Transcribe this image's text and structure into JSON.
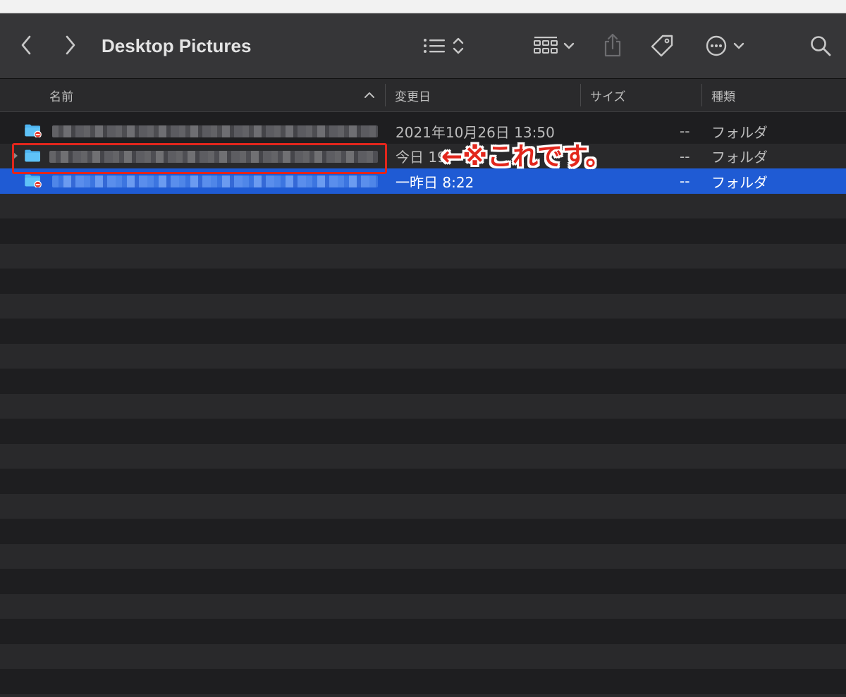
{
  "window": {
    "title": "Desktop Pictures"
  },
  "toolbar": {
    "icons": [
      "chevron-left-icon",
      "chevron-right-icon",
      "list-view-icon",
      "up-down-arrows-icon",
      "grid-group-icon",
      "chevron-down-icon",
      "share-icon",
      "tag-icon",
      "more-ellipsis-icon",
      "search-icon"
    ]
  },
  "columns": {
    "name": "名前",
    "modified": "変更日",
    "size": "サイズ",
    "kind": "種類"
  },
  "rows": [
    {
      "name": "",
      "modified": "2021年10月26日 13:50",
      "size": "--",
      "kind": "フォルダ",
      "icon": "folder-restricted-icon",
      "selected": false
    },
    {
      "name": "",
      "modified": "今日 19:",
      "size": "--",
      "kind": "フォルダ",
      "icon": "folder-icon",
      "selected": false
    },
    {
      "name": "",
      "modified": "一昨日 8:22",
      "size": "--",
      "kind": "フォルダ",
      "icon": "folder-restricted-icon",
      "selected": true
    }
  ],
  "annotation": {
    "text": "←※これです。",
    "color": "#e2261c"
  },
  "colors": {
    "toolbar": "#363638",
    "selection": "#1f5bd4",
    "folder": "#4db3f0",
    "badge": "#e53b30"
  }
}
